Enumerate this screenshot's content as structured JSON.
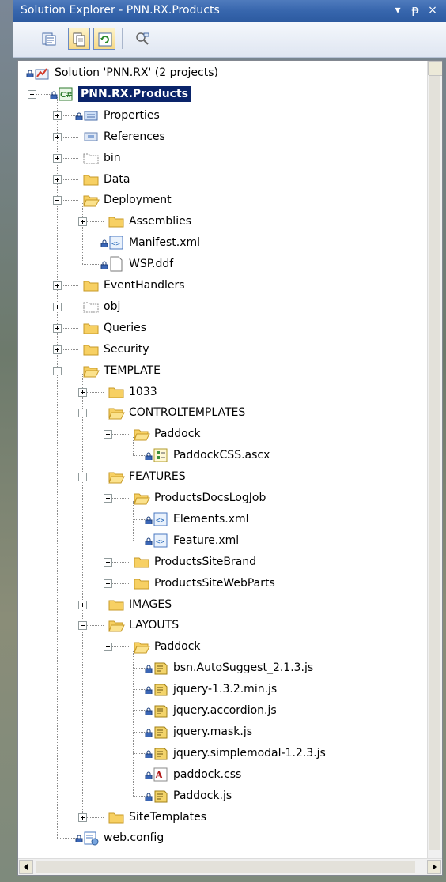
{
  "window": {
    "title": "Solution Explorer - PNN.RX.Products",
    "controls": {
      "dropdown": "▾",
      "pin": "ᵽ",
      "close": "×"
    }
  },
  "toolbar": {
    "buttons": [
      "properties-icon",
      "show-all-files-icon",
      "refresh-icon",
      "view-class-diagram-icon"
    ]
  },
  "tree": {
    "items": [
      {
        "label": "Solution 'PNN.RX' (2 projects)",
        "icon": "solution-icon",
        "level": 0,
        "expander": "none",
        "lock": true
      },
      {
        "label": "PNN.RX.Products",
        "icon": "csharp-project-icon",
        "level": 1,
        "expander": "minus",
        "lock": true,
        "selected": true
      },
      {
        "label": "Properties",
        "icon": "properties-folder-icon",
        "level": 2,
        "expander": "plus",
        "lock": true
      },
      {
        "label": "References",
        "icon": "references-icon",
        "level": 2,
        "expander": "plus",
        "lock": false
      },
      {
        "label": "bin",
        "icon": "hidden-folder-icon",
        "level": 2,
        "expander": "plus",
        "lock": false
      },
      {
        "label": "Data",
        "icon": "folder-icon",
        "level": 2,
        "expander": "plus",
        "lock": false
      },
      {
        "label": "Deployment",
        "icon": "open-folder-icon",
        "level": 2,
        "expander": "minus",
        "lock": false
      },
      {
        "label": "Assemblies",
        "icon": "folder-icon",
        "level": 3,
        "expander": "plus",
        "lock": false
      },
      {
        "label": "Manifest.xml",
        "icon": "xml-file-icon",
        "level": 3,
        "expander": "none",
        "lock": true
      },
      {
        "label": "WSP.ddf",
        "icon": "file-icon",
        "level": 3,
        "expander": "none",
        "lock": true
      },
      {
        "label": "EventHandlers",
        "icon": "folder-icon",
        "level": 2,
        "expander": "plus",
        "lock": false
      },
      {
        "label": "obj",
        "icon": "hidden-folder-icon",
        "level": 2,
        "expander": "plus",
        "lock": false
      },
      {
        "label": "Queries",
        "icon": "folder-icon",
        "level": 2,
        "expander": "plus",
        "lock": false
      },
      {
        "label": "Security",
        "icon": "folder-icon",
        "level": 2,
        "expander": "plus",
        "lock": false
      },
      {
        "label": "TEMPLATE",
        "icon": "open-folder-icon",
        "level": 2,
        "expander": "minus",
        "lock": false
      },
      {
        "label": "1033",
        "icon": "folder-icon",
        "level": 3,
        "expander": "plus",
        "lock": false
      },
      {
        "label": "CONTROLTEMPLATES",
        "icon": "open-folder-icon",
        "level": 3,
        "expander": "minus",
        "lock": false
      },
      {
        "label": "Paddock",
        "icon": "open-folder-icon",
        "level": 4,
        "expander": "minus",
        "lock": false
      },
      {
        "label": "PaddockCSS.ascx",
        "icon": "ascx-file-icon",
        "level": 5,
        "expander": "none",
        "lock": true
      },
      {
        "label": "FEATURES",
        "icon": "open-folder-icon",
        "level": 3,
        "expander": "minus",
        "lock": false
      },
      {
        "label": "ProductsDocsLogJob",
        "icon": "open-folder-icon",
        "level": 4,
        "expander": "minus",
        "lock": false
      },
      {
        "label": "Elements.xml",
        "icon": "xml-file-icon",
        "level": 5,
        "expander": "none",
        "lock": true
      },
      {
        "label": "Feature.xml",
        "icon": "xml-file-icon",
        "level": 5,
        "expander": "none",
        "lock": true
      },
      {
        "label": "ProductsSiteBrand",
        "icon": "folder-icon",
        "level": 4,
        "expander": "plus",
        "lock": false
      },
      {
        "label": "ProductsSiteWebParts",
        "icon": "folder-icon",
        "level": 4,
        "expander": "plus",
        "lock": false
      },
      {
        "label": "IMAGES",
        "icon": "folder-icon",
        "level": 3,
        "expander": "plus",
        "lock": false
      },
      {
        "label": "LAYOUTS",
        "icon": "open-folder-icon",
        "level": 3,
        "expander": "minus",
        "lock": false
      },
      {
        "label": "Paddock",
        "icon": "open-folder-icon",
        "level": 4,
        "expander": "minus",
        "lock": false
      },
      {
        "label": "bsn.AutoSuggest_2.1.3.js",
        "icon": "js-file-icon",
        "level": 5,
        "expander": "none",
        "lock": true
      },
      {
        "label": "jquery-1.3.2.min.js",
        "icon": "js-file-icon",
        "level": 5,
        "expander": "none",
        "lock": true
      },
      {
        "label": "jquery.accordion.js",
        "icon": "js-file-icon",
        "level": 5,
        "expander": "none",
        "lock": true
      },
      {
        "label": "jquery.mask.js",
        "icon": "js-file-icon",
        "level": 5,
        "expander": "none",
        "lock": true
      },
      {
        "label": "jquery.simplemodal-1.2.3.js",
        "icon": "js-file-icon",
        "level": 5,
        "expander": "none",
        "lock": true
      },
      {
        "label": "paddock.css",
        "icon": "css-file-icon",
        "level": 5,
        "expander": "none",
        "lock": true
      },
      {
        "label": "Paddock.js",
        "icon": "js-file-icon",
        "level": 5,
        "expander": "none",
        "lock": true
      },
      {
        "label": "SiteTemplates",
        "icon": "folder-icon",
        "level": 3,
        "expander": "plus",
        "lock": false
      },
      {
        "label": "web.config",
        "icon": "config-file-icon",
        "level": 2,
        "expander": "none",
        "lock": true
      }
    ]
  },
  "colors": {
    "selection": "#0a246a",
    "titlebar": "#3766ad",
    "folder": "#f2c94c"
  }
}
